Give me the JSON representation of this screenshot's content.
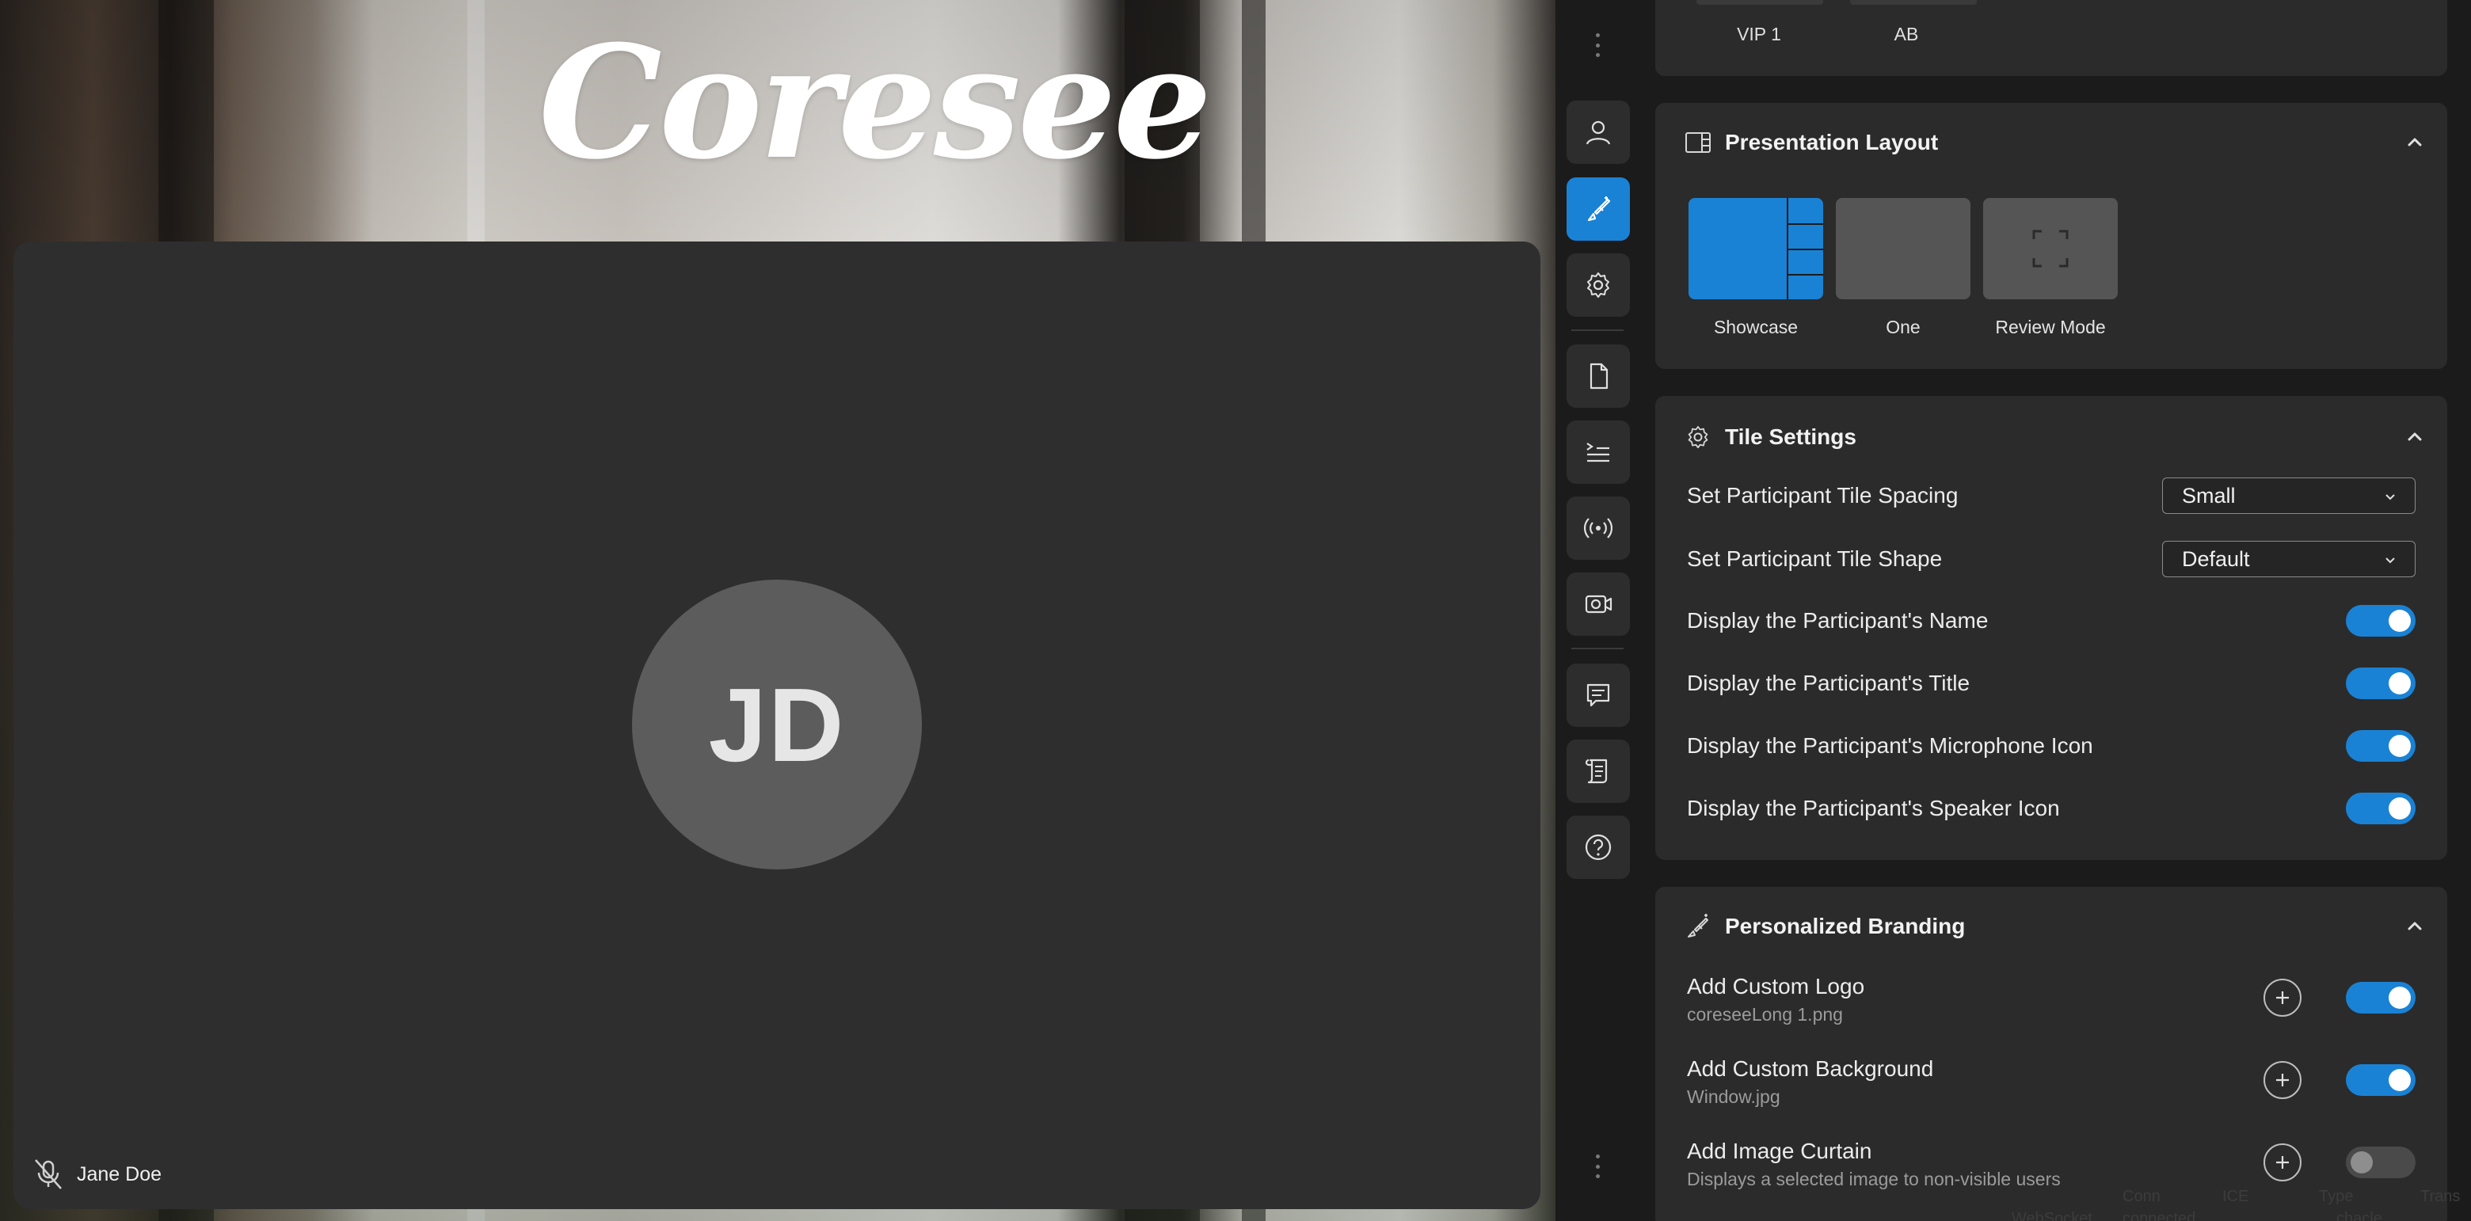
{
  "stage": {
    "logo_text": "Coresee",
    "participant": {
      "initials": "JD",
      "name": "Jane Doe",
      "mic_muted": true
    }
  },
  "rail": {
    "items": [
      {
        "icon": "user-icon",
        "active": false
      },
      {
        "icon": "paintbrush-icon",
        "active": true
      },
      {
        "icon": "gear-icon",
        "active": false
      },
      {
        "icon": "document-icon",
        "active": false
      },
      {
        "icon": "prompt-list-icon",
        "active": false
      },
      {
        "icon": "broadcast-icon",
        "active": false
      },
      {
        "icon": "camera-icon",
        "active": false
      },
      {
        "icon": "chat-icon",
        "active": false
      },
      {
        "icon": "scroll-icon",
        "active": false
      },
      {
        "icon": "help-icon",
        "active": false
      }
    ]
  },
  "panel": {
    "top_card": {
      "labels": [
        "VIP 1",
        "AB"
      ]
    },
    "presentation_layout": {
      "title": "Presentation Layout",
      "options": [
        {
          "label": "Showcase",
          "selected": true
        },
        {
          "label": "One",
          "selected": false
        },
        {
          "label": "Review Mode",
          "selected": false
        }
      ]
    },
    "tile_settings": {
      "title": "Tile Settings",
      "spacing": {
        "label": "Set Participant Tile Spacing",
        "value": "Small"
      },
      "shape": {
        "label": "Set Participant Tile Shape",
        "value": "Default"
      },
      "toggles": [
        {
          "label": "Display the Participant's Name",
          "on": true
        },
        {
          "label": "Display the Participant's Title",
          "on": true
        },
        {
          "label": "Display the Participant's Microphone Icon",
          "on": true
        },
        {
          "label": "Display the Participant's Speaker Icon",
          "on": true
        }
      ]
    },
    "branding": {
      "title": "Personalized Branding",
      "items": [
        {
          "label": "Add Custom Logo",
          "sub": "coreseeLong 1.png",
          "on": true
        },
        {
          "label": "Add Custom Background",
          "sub": "Window.jpg",
          "on": true
        },
        {
          "label": "Add Image Curtain",
          "sub": "Displays a selected image to non-visible users",
          "on": false
        }
      ]
    }
  },
  "ghost_overlay": {
    "items": [
      "Conn",
      "ICE",
      "Type",
      "Trans",
      "WebSocket",
      "connected",
      "chacle"
    ]
  },
  "colors": {
    "accent": "#1a82d4",
    "panel_bg": "#1b1b1b",
    "card_bg": "#2b2b2b",
    "tile_bg": "#2e2e2e"
  }
}
